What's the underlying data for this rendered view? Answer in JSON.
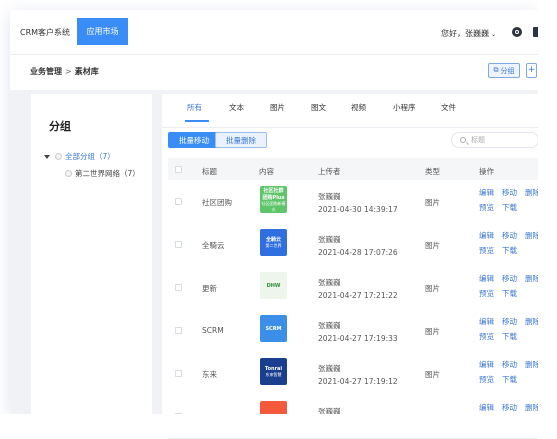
{
  "topnav": {
    "brand": "CRM客户系统",
    "active_tab": "应用市场",
    "greeting": "您好，张巍巍",
    "caret": "⌄"
  },
  "breadcrumb": {
    "parent": "业务管理",
    "separator": ">",
    "current": "素材库"
  },
  "header_actions": {
    "group_label": "分组",
    "plus_label": "+"
  },
  "left_panel": {
    "title": "分组",
    "tree": [
      {
        "label": "全部分组（7）"
      },
      {
        "label": "第二世界网络（7）"
      }
    ]
  },
  "tabs": [
    "所有",
    "文本",
    "图片",
    "图文",
    "视频",
    "小程序",
    "文件"
  ],
  "active_tab_index": 0,
  "toolbar": {
    "batch_move": "批量移动",
    "batch_delete": "批量删除",
    "search_placeholder": "标题"
  },
  "table": {
    "headers": [
      "标题",
      "内容",
      "上传者",
      "类型",
      "操作"
    ],
    "ops_row1": [
      "编辑",
      "移动",
      "删除"
    ],
    "ops_row2": [
      "预览",
      "下载"
    ],
    "rows": [
      {
        "title": "社区团购",
        "uploader": "张巍巍",
        "time": "2021-04-30 14:39:17",
        "type": "图片",
        "thumb_text": "社区社群\n团购Plus",
        "thumb_color": "#5fc56a",
        "thumb_sub": "社区团购新模式"
      },
      {
        "title": "全騎云",
        "uploader": "张巍巍",
        "time": "2021-04-28 17:07:26",
        "type": "图片",
        "thumb_text": "全騎云",
        "thumb_color": "#2f6fe0",
        "thumb_sub": "第二世界"
      },
      {
        "title": "更新",
        "uploader": "张巍巍",
        "time": "2021-04-27 17:21:22",
        "type": "图片",
        "thumb_text": "DHW",
        "thumb_color": "#eef5ea",
        "thumb_sub": ""
      },
      {
        "title": "SCRM",
        "uploader": "张巍巍",
        "time": "2021-04-27 17:19:33",
        "type": "图片",
        "thumb_text": "SCRM",
        "thumb_color": "#3b8fe8",
        "thumb_sub": ""
      },
      {
        "title": "东来",
        "uploader": "张巍巍",
        "time": "2021-04-27 17:19:12",
        "type": "图片",
        "thumb_text": "Tonrai",
        "thumb_color": "#1a3f8f",
        "thumb_sub": "东来智慧"
      },
      {
        "title": "",
        "uploader": "张巍巍",
        "time": "",
        "type": "",
        "thumb_text": "",
        "thumb_color": "#f25a3b",
        "thumb_sub": ""
      }
    ]
  }
}
